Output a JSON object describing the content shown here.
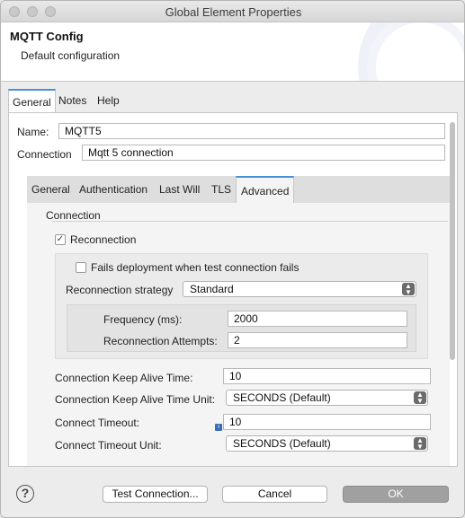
{
  "window": {
    "title": "Global Element Properties"
  },
  "header": {
    "title": "MQTT Config",
    "subtitle": "Default configuration"
  },
  "outer_tabs": [
    {
      "label": "General",
      "active": true
    },
    {
      "label": "Notes",
      "active": false
    },
    {
      "label": "Help",
      "active": false
    }
  ],
  "general": {
    "name_label": "Name:",
    "name_value": "MQTT5",
    "connection_label": "Connection",
    "connection_value": "Mqtt 5 connection"
  },
  "inner_tabs": [
    {
      "label": "General",
      "active": false
    },
    {
      "label": "Authentication",
      "active": false
    },
    {
      "label": "Last Will",
      "active": false
    },
    {
      "label": "TLS",
      "active": false
    },
    {
      "label": "Advanced",
      "active": true
    }
  ],
  "advanced": {
    "section_title": "Connection",
    "reconnection_label": "Reconnection",
    "reconnection_checked": true,
    "fails_deployment_label": "Fails deployment when test connection fails",
    "fails_deployment_checked": false,
    "strategy_label": "Reconnection strategy",
    "strategy_value": "Standard",
    "frequency_label": "Frequency (ms):",
    "frequency_value": "2000",
    "attempts_label": "Reconnection Attempts:",
    "attempts_value": "2",
    "keep_alive_label": "Connection Keep Alive Time:",
    "keep_alive_value": "10",
    "keep_alive_unit_label": "Connection Keep Alive Time Unit:",
    "keep_alive_unit_value": "SECONDS (Default)",
    "timeout_label": "Connect Timeout:",
    "timeout_value": "10",
    "timeout_unit_label": "Connect Timeout Unit:",
    "timeout_unit_value": "SECONDS (Default)"
  },
  "footer": {
    "help_symbol": "?",
    "test_connection_label": "Test Connection...",
    "cancel_label": "Cancel",
    "ok_label": "OK"
  },
  "colors": {
    "accent": "#4a90d9",
    "default_button": "#a0a0a0"
  }
}
